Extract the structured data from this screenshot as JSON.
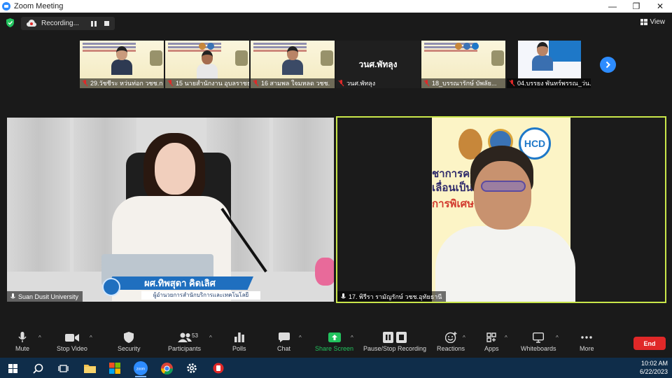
{
  "window": {
    "title": "Zoom Meeting",
    "controls": [
      "—",
      "❐",
      "✕"
    ]
  },
  "topbar": {
    "recording_label": "Recording...",
    "view_label": "View"
  },
  "thumbnails": [
    {
      "name": "29.วัชชีระ หว่นท่อก วชช.ก",
      "type": "video"
    },
    {
      "name": "15 นายสำนักงาน อุบลราชธานี",
      "type": "video"
    },
    {
      "name": "16 สามพล ใจมหลด วชช.",
      "type": "video"
    },
    {
      "name": "วนศ.พัทลุง",
      "type": "name-only",
      "center_label": "วนศ.พัทลุง"
    },
    {
      "name": "18_บรรณารักษ์ บัพลัย...",
      "type": "slide"
    },
    {
      "name": "04.บรรยง พันทร์พรรณ_ว่น...",
      "type": "video"
    }
  ],
  "left_tile": {
    "participant": "Suan Dusit University",
    "lower_third_name": "ผศ.ทิพสุดา คิดเลิศ",
    "lower_third_title": "ผู้อำนวยการสำนักบริการและเทคโนโลยีสารสนเทศ"
  },
  "right_tile": {
    "participant": "17. พิรีรา รามัญรักษ์ วชช.อุทัยธานี",
    "poster_line1": "ชาการครู ทางการศึ",
    "poster_line2": "เลื่อนเป็น",
    "poster_line3": "การพิเศษ",
    "poster_logo": "HCD"
  },
  "toolbar": {
    "items": [
      {
        "id": "mute",
        "label": "Mute"
      },
      {
        "id": "stop-video",
        "label": "Stop Video"
      },
      {
        "id": "security",
        "label": "Security"
      },
      {
        "id": "participants",
        "label": "Participants",
        "count": "53"
      },
      {
        "id": "polls",
        "label": "Polls"
      },
      {
        "id": "chat",
        "label": "Chat"
      },
      {
        "id": "share-screen",
        "label": "Share Screen"
      },
      {
        "id": "pause-stop-recording",
        "label": "Pause/Stop Recording"
      },
      {
        "id": "reactions",
        "label": "Reactions"
      },
      {
        "id": "apps",
        "label": "Apps"
      },
      {
        "id": "whiteboards",
        "label": "Whiteboards"
      },
      {
        "id": "more",
        "label": "More"
      }
    ],
    "end_label": "End"
  },
  "taskbar": {
    "time": "10:02 AM",
    "date": "6/22/2023",
    "zoom_icon_label": "zoom"
  },
  "colors": {
    "accent": "#2d8cff",
    "active_speaker": "#c9e64a",
    "share_green": "#22c35e",
    "end_red": "#e02828",
    "taskbar": "#0f2d4a"
  }
}
